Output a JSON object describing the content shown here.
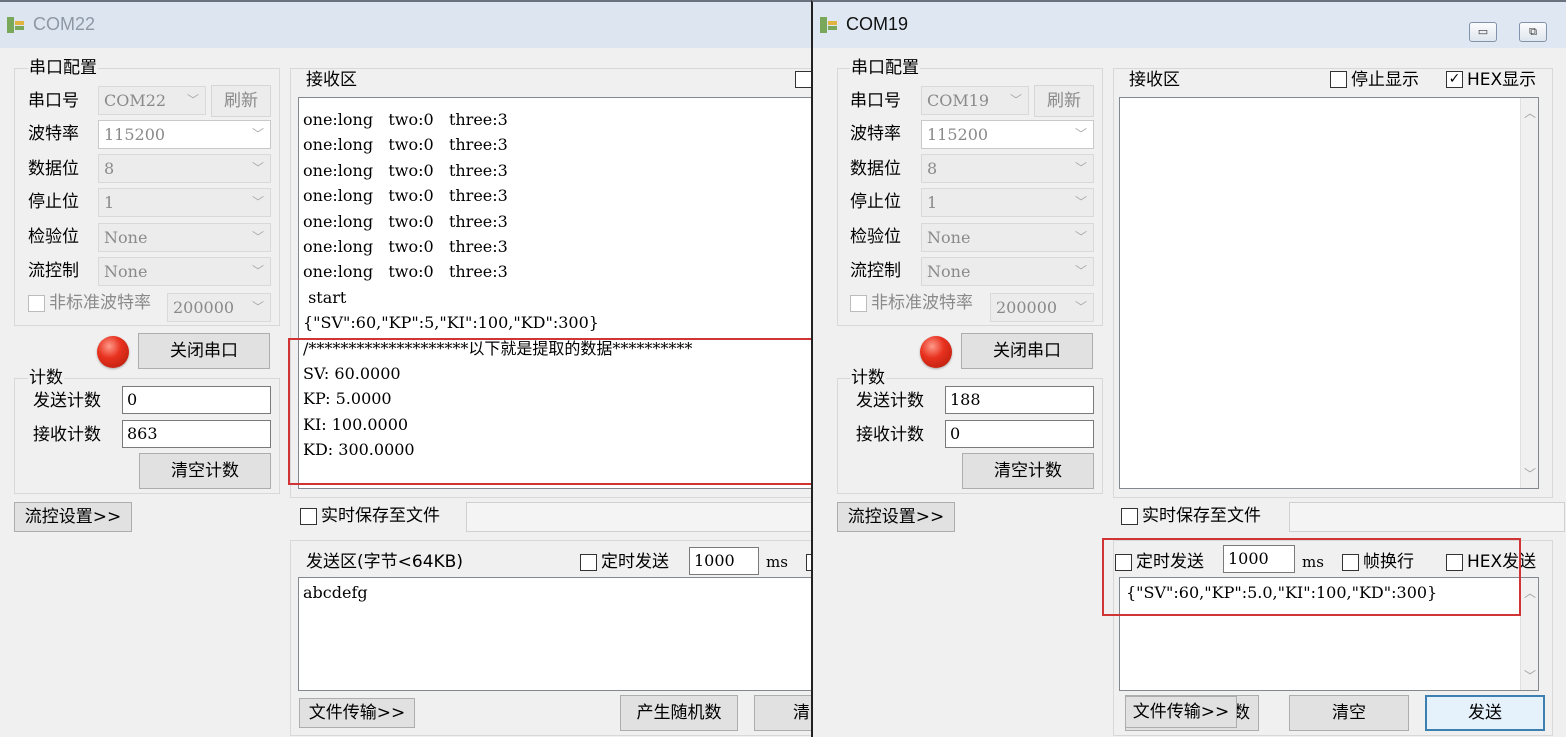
{
  "windows": [
    {
      "title": "COM22",
      "serial_config": {
        "group_label": "串口配置",
        "port_label": "串口号",
        "port_value": "COM22",
        "refresh_label": "刷新",
        "baud_label": "波特率",
        "baud_value": "115200",
        "databits_label": "数据位",
        "databits_value": "8",
        "stopbits_label": "停止位",
        "stopbits_value": "1",
        "parity_label": "检验位",
        "parity_value": "None",
        "flow_label": "流控制",
        "flow_value": "None",
        "nonstd_label": "非标准波特率",
        "nonstd_value": "200000",
        "close_port_label": "关闭串口"
      },
      "counter": {
        "group_label": "计数",
        "send_label": "发送计数",
        "send_value": "0",
        "recv_label": "接收计数",
        "recv_value": "863",
        "clear_label": "清空计数"
      },
      "flow_settings_label": "流控设置>>",
      "receive": {
        "label": "接收区",
        "lines": [
          "one:long   two:0   three:3",
          "one:long   two:0   three:3",
          "one:long   two:0   three:3",
          "one:long   two:0   three:3",
          "one:long   two:0   three:3",
          "one:long   two:0   three:3",
          "one:long   two:0   three:3",
          " start",
          "{\"SV\":60,\"KP\":5,\"KI\":100,\"KD\":300}",
          "/********************以下就是提取的数据**********",
          "SV: 60.0000",
          "KP: 5.0000",
          "KI: 100.0000",
          "KD: 300.0000"
        ]
      },
      "save_to_file_label": "实时保存至文件",
      "send": {
        "label": "发送区(字节<64KB)",
        "timed_send_label": "定时发送",
        "interval_value": "1000",
        "interval_unit": "ms",
        "text": "abcdefg"
      },
      "bottom": {
        "file_transfer_label": "文件传输>>",
        "random_label": "产生随机数",
        "clear_partial": "清"
      }
    },
    {
      "title": "COM19",
      "title_buttons": {
        "minimize": "▭",
        "restore": "⧉"
      },
      "serial_config": {
        "group_label": "串口配置",
        "port_label": "串口号",
        "port_value": "COM19",
        "refresh_label": "刷新",
        "baud_label": "波特率",
        "baud_value": "115200",
        "databits_label": "数据位",
        "databits_value": "8",
        "stopbits_label": "停止位",
        "stopbits_value": "1",
        "parity_label": "检验位",
        "parity_value": "None",
        "flow_label": "流控制",
        "flow_value": "None",
        "nonstd_label": "非标准波特率",
        "nonstd_value": "200000",
        "close_port_label": "关闭串口"
      },
      "counter": {
        "group_label": "计数",
        "send_label": "发送计数",
        "send_value": "188",
        "recv_label": "接收计数",
        "recv_value": "0",
        "clear_label": "清空计数"
      },
      "flow_settings_label": "流控设置>>",
      "receive": {
        "label": "接收区",
        "stop_display_label": "停止显示",
        "hex_display_label": "HEX显示",
        "hex_display_checked": "✓"
      },
      "save_to_file_label": "实时保存至文件",
      "send": {
        "timed_send_label": "定时发送",
        "interval_value": "1000",
        "interval_unit": "ms",
        "frame_newline_label": "帧换行",
        "hex_send_label": "HEX发送",
        "text": "{\"SV\":60,\"KP\":5.0,\"KI\":100,\"KD\":300}"
      },
      "bottom": {
        "file_transfer_label": "文件传输>>",
        "partial_label": "数",
        "clear_label": "清空",
        "send_label": "发送"
      }
    }
  ],
  "colors": {
    "highlight_box": "#d03434",
    "led": "#e8321f",
    "accent": "#3c7fb1"
  }
}
